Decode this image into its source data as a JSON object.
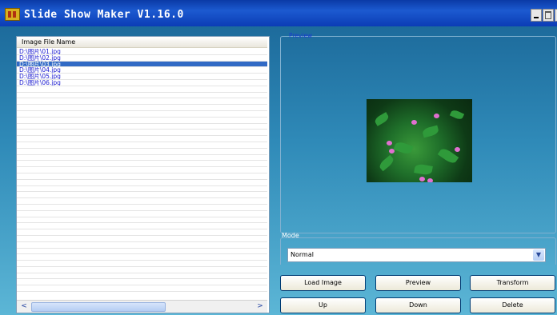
{
  "window": {
    "title": "Slide Show Maker V1.16.0"
  },
  "file_list": {
    "header": "Image File Name",
    "items": [
      {
        "label": "D:\\图片\\01.jpg",
        "selected": false
      },
      {
        "label": "D:\\图片\\02.jpg",
        "selected": false
      },
      {
        "label": "D:\\图片\\03.jpg",
        "selected": true
      },
      {
        "label": "D:\\图片\\04.jpg",
        "selected": false
      },
      {
        "label": "D:\\图片\\05.jpg",
        "selected": false
      },
      {
        "label": "D:\\图片\\06.jpg",
        "selected": false
      }
    ],
    "empty_rows": 33,
    "scroll_left": "<",
    "scroll_right": ">"
  },
  "preview": {
    "label": "Preview"
  },
  "mode": {
    "label": "Mode",
    "selected_value": "Normal"
  },
  "buttons": {
    "load_image": "Load Image",
    "preview": "Preview",
    "transform": "Transform",
    "up": "Up",
    "down": "Down",
    "delete": "Delete"
  },
  "colors": {
    "title_bar": "#0a3aa6",
    "selection": "#316ac5",
    "list_text": "#1a1ad0"
  }
}
